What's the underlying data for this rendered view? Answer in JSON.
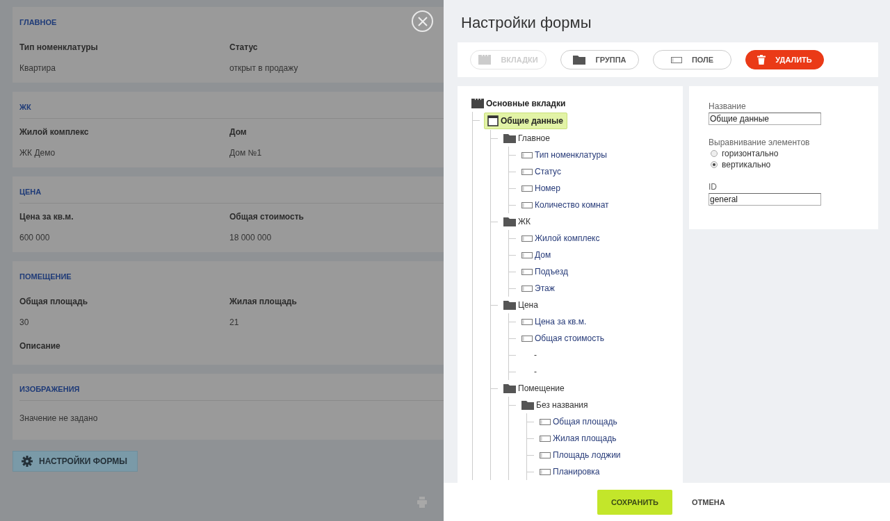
{
  "form": {
    "sections": [
      {
        "title": "ГЛАВНОЕ",
        "divider": false,
        "fields": [
          {
            "label": "Тип номенклатуры",
            "value": "Квартира"
          },
          {
            "label": "Статус",
            "value": "открыт в продажу"
          }
        ]
      },
      {
        "title": "ЖК",
        "divider": true,
        "fields": [
          {
            "label": "Жилой комплекс",
            "value": "ЖК Демо"
          },
          {
            "label": "Дом",
            "value": "Дом №1"
          }
        ]
      },
      {
        "title": "ЦЕНА",
        "divider": true,
        "fields": [
          {
            "label": "Цена за кв.м.",
            "value": "600 000"
          },
          {
            "label": "Общая стоимость",
            "value": "18 000 000"
          }
        ]
      },
      {
        "title": "ПОМЕЩЕНИЕ",
        "divider": false,
        "fields": [
          {
            "label": "Общая площадь",
            "value": "30"
          },
          {
            "label": "Жилая площадь",
            "value": "21"
          },
          {
            "label": "Описание"
          }
        ]
      },
      {
        "title": "ИЗОБРАЖЕНИЯ",
        "divider": true,
        "note": "Значение не задано"
      }
    ],
    "settings_button": "НАСТРОЙКИ ФОРМЫ"
  },
  "panel": {
    "title": "Настройки формы",
    "toolbar": [
      {
        "label": "ВКЛАДКИ",
        "kind": "tabs",
        "disabled": true
      },
      {
        "label": "ГРУППА",
        "kind": "group",
        "disabled": false
      },
      {
        "label": "ПОЛЕ",
        "kind": "field",
        "disabled": false
      },
      {
        "label": "УДАЛИТЬ",
        "kind": "delete",
        "disabled": false
      }
    ],
    "tree": {
      "label": "Основные вкладки",
      "kind": "tabs",
      "selected": false,
      "children": [
        {
          "label": "Общие данные",
          "kind": "tab",
          "selected": true,
          "children": [
            {
              "label": "Главное",
              "kind": "group",
              "selected": false,
              "children": [
                {
                  "label": "Тип номенклатуры",
                  "kind": "field",
                  "selected": false
                },
                {
                  "label": "Статус",
                  "kind": "field",
                  "selected": false
                },
                {
                  "label": "Номер",
                  "kind": "field",
                  "selected": false
                },
                {
                  "label": "Количество комнат",
                  "kind": "field",
                  "selected": false
                }
              ]
            },
            {
              "label": "ЖК",
              "kind": "group",
              "selected": false,
              "children": [
                {
                  "label": "Жилой комплекс",
                  "kind": "field",
                  "selected": false
                },
                {
                  "label": "Дом",
                  "kind": "field",
                  "selected": false
                },
                {
                  "label": "Подъезд",
                  "kind": "field",
                  "selected": false
                },
                {
                  "label": "Этаж",
                  "kind": "field",
                  "selected": false
                }
              ]
            },
            {
              "label": "Цена",
              "kind": "group",
              "selected": false,
              "children": [
                {
                  "label": "Цена за кв.м.",
                  "kind": "field",
                  "selected": false
                },
                {
                  "label": "Общая стоимость",
                  "kind": "field",
                  "selected": false
                },
                {
                  "label": "-",
                  "kind": "blank",
                  "selected": false
                },
                {
                  "label": "-",
                  "kind": "blank",
                  "selected": false
                }
              ]
            },
            {
              "label": "Помещение",
              "kind": "group",
              "selected": false,
              "children": [
                {
                  "label": "Без названия",
                  "kind": "group",
                  "selected": false,
                  "children": [
                    {
                      "label": "Общая площадь",
                      "kind": "field",
                      "selected": false
                    },
                    {
                      "label": "Жилая площадь",
                      "kind": "field",
                      "selected": false
                    },
                    {
                      "label": "Площадь лоджии",
                      "kind": "field",
                      "selected": false
                    },
                    {
                      "label": "Планировка",
                      "kind": "field",
                      "selected": false
                    }
                  ]
                }
              ]
            }
          ]
        }
      ]
    },
    "properties": {
      "name_label": "Название",
      "name_value": "Общие данные",
      "align_label": "Выравнивание элементов",
      "align_options": [
        {
          "label": "горизонтально",
          "selected": false
        },
        {
          "label": "вертикально",
          "selected": true
        }
      ],
      "id_label": "ID",
      "id_value": "general"
    },
    "footer": {
      "save": "СОХРАНИТЬ",
      "cancel": "ОТМЕНА"
    }
  }
}
